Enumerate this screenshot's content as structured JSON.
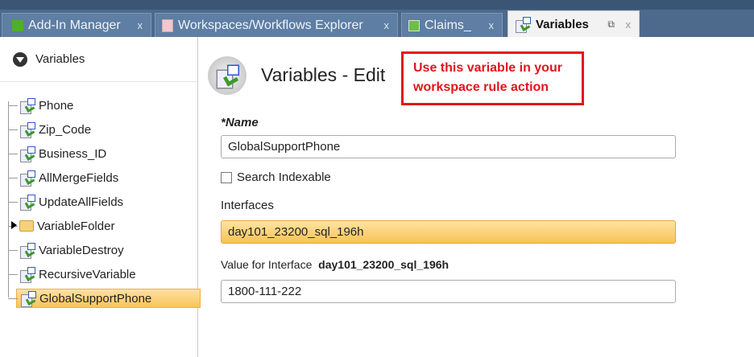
{
  "tabs": [
    {
      "label": "Add-In Manager",
      "close": "x"
    },
    {
      "label": "Workspaces/Workflows Explorer",
      "close": "x"
    },
    {
      "label": "Claims_",
      "close": "x"
    },
    {
      "label": "Variables",
      "close": "x",
      "active": true
    }
  ],
  "sidebar": {
    "title": "Variables",
    "items": [
      {
        "label": "Phone"
      },
      {
        "label": "Zip_Code"
      },
      {
        "label": "Business_ID"
      },
      {
        "label": "AllMergeFields"
      },
      {
        "label": "UpdateAllFields"
      },
      {
        "label": "VariableFolder",
        "type": "folder"
      },
      {
        "label": "VariableDestroy"
      },
      {
        "label": "RecursiveVariable"
      },
      {
        "label": "GlobalSupportPhone",
        "selected": true
      }
    ]
  },
  "main": {
    "title": "Variables - Edit",
    "annotation": "Use this variable in your workspace rule action",
    "name_label": "*Name",
    "name_value": "GlobalSupportPhone",
    "search_indexable": "Search Indexable",
    "interfaces_label": "Interfaces",
    "interface_value": "day101_23200_sql_196h",
    "value_for_label": "Value for Interface",
    "value_for_interface": "day101_23200_sql_196h",
    "value": "1800-111-222"
  }
}
